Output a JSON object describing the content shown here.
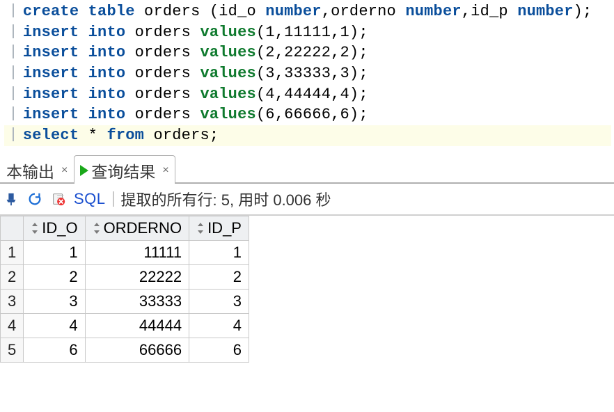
{
  "code": {
    "lines": [
      {
        "idx": 0,
        "segments": [
          {
            "t": "create",
            "c": "kw"
          },
          {
            "t": " ",
            "c": "id"
          },
          {
            "t": "table",
            "c": "kw"
          },
          {
            "t": " orders (id_o ",
            "c": "id"
          },
          {
            "t": "number",
            "c": "dt"
          },
          {
            "t": ",orderno ",
            "c": "id"
          },
          {
            "t": "number",
            "c": "dt"
          },
          {
            "t": ",id_p ",
            "c": "id"
          },
          {
            "t": "number",
            "c": "dt"
          },
          {
            "t": ");",
            "c": "punct"
          }
        ]
      },
      {
        "idx": 1,
        "segments": [
          {
            "t": "insert",
            "c": "kw"
          },
          {
            "t": " ",
            "c": "id"
          },
          {
            "t": "into",
            "c": "kw"
          },
          {
            "t": " orders ",
            "c": "id"
          },
          {
            "t": "values",
            "c": "fn"
          },
          {
            "t": "(",
            "c": "punct"
          },
          {
            "t": "1,11111,1",
            "c": "id"
          },
          {
            "t": ");",
            "c": "punct"
          }
        ]
      },
      {
        "idx": 2,
        "segments": [
          {
            "t": "insert",
            "c": "kw"
          },
          {
            "t": " ",
            "c": "id"
          },
          {
            "t": "into",
            "c": "kw"
          },
          {
            "t": " orders ",
            "c": "id"
          },
          {
            "t": "values",
            "c": "fn"
          },
          {
            "t": "(",
            "c": "punct"
          },
          {
            "t": "2,22222,2",
            "c": "id"
          },
          {
            "t": ");",
            "c": "punct"
          }
        ]
      },
      {
        "idx": 3,
        "segments": [
          {
            "t": "insert",
            "c": "kw"
          },
          {
            "t": " ",
            "c": "id"
          },
          {
            "t": "into",
            "c": "kw"
          },
          {
            "t": " orders ",
            "c": "id"
          },
          {
            "t": "values",
            "c": "fn"
          },
          {
            "t": "(",
            "c": "punct"
          },
          {
            "t": "3,33333,3",
            "c": "id"
          },
          {
            "t": ");",
            "c": "punct"
          }
        ]
      },
      {
        "idx": 4,
        "segments": [
          {
            "t": "insert",
            "c": "kw"
          },
          {
            "t": " ",
            "c": "id"
          },
          {
            "t": "into",
            "c": "kw"
          },
          {
            "t": " orders ",
            "c": "id"
          },
          {
            "t": "values",
            "c": "fn"
          },
          {
            "t": "(",
            "c": "punct"
          },
          {
            "t": "4,44444,4",
            "c": "id"
          },
          {
            "t": ");",
            "c": "punct"
          }
        ]
      },
      {
        "idx": 5,
        "segments": [
          {
            "t": "insert",
            "c": "kw"
          },
          {
            "t": " ",
            "c": "id"
          },
          {
            "t": "into",
            "c": "kw"
          },
          {
            "t": " orders ",
            "c": "id"
          },
          {
            "t": "values",
            "c": "fn"
          },
          {
            "t": "(",
            "c": "punct"
          },
          {
            "t": "6,66666,6",
            "c": "id"
          },
          {
            "t": ");",
            "c": "punct"
          }
        ]
      },
      {
        "idx": 6,
        "hl": true,
        "segments": [
          {
            "t": "select",
            "c": "kw"
          },
          {
            "t": " * ",
            "c": "id"
          },
          {
            "t": "from",
            "c": "kw"
          },
          {
            "t": " orders;",
            "c": "id"
          }
        ]
      }
    ]
  },
  "tabs": {
    "script_output_label": "本输出",
    "query_result_label": "查询结果"
  },
  "toolbar": {
    "sql_label": "SQL",
    "status_text": "提取的所有行: 5, 用时 0.006 秒"
  },
  "results": {
    "columns": [
      "ID_O",
      "ORDERNO",
      "ID_P"
    ],
    "rows": [
      {
        "n": "1",
        "cells": [
          "1",
          "11111",
          "1"
        ]
      },
      {
        "n": "2",
        "cells": [
          "2",
          "22222",
          "2"
        ]
      },
      {
        "n": "3",
        "cells": [
          "3",
          "33333",
          "3"
        ]
      },
      {
        "n": "4",
        "cells": [
          "4",
          "44444",
          "4"
        ]
      },
      {
        "n": "5",
        "cells": [
          "6",
          "66666",
          "6"
        ]
      }
    ]
  }
}
